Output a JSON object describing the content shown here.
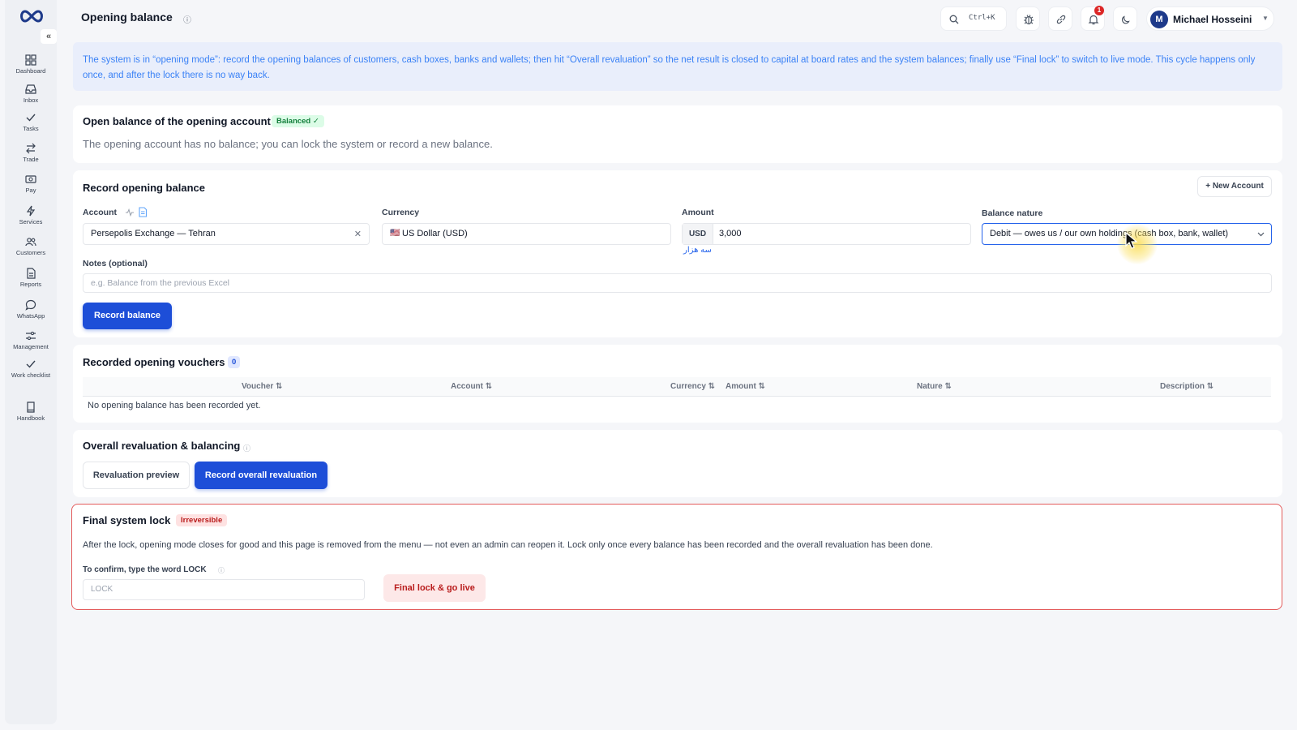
{
  "header": {
    "title": "Opening balance",
    "search_shortcut": "Ctrl+K",
    "notification_count": "1",
    "user_initial": "M",
    "user_name": "Michael Hosseini"
  },
  "sidebar": {
    "items": [
      {
        "label": "Dashboard",
        "icon": "dashboard-icon"
      },
      {
        "label": "Inbox",
        "icon": "inbox-icon"
      },
      {
        "label": "Tasks",
        "icon": "check-icon"
      },
      {
        "label": "Trade",
        "icon": "swap-icon"
      },
      {
        "label": "Pay",
        "icon": "pay-icon"
      },
      {
        "label": "Services",
        "icon": "bolt-icon"
      },
      {
        "label": "Customers",
        "icon": "users-icon"
      },
      {
        "label": "Reports",
        "icon": "report-icon"
      },
      {
        "label": "WhatsApp",
        "icon": "chat-icon"
      },
      {
        "label": "Management",
        "icon": "sliders-icon"
      },
      {
        "label": "Work checklist",
        "icon": "check-icon"
      },
      {
        "label": "Handbook",
        "icon": "book-icon"
      }
    ]
  },
  "banner": {
    "text": "The system is in “opening mode”: record the opening balances of customers, cash boxes, banks and wallets; then hit “Overall revaluation” so the net result is closed to capital at board rates and the system balances; finally use “Final lock” to switch to live mode. This cycle happens only once, and after the lock there is no way back."
  },
  "opening_account": {
    "title": "Open balance of the opening account",
    "status": "Balanced ✓",
    "message": "The opening account has no balance; you can lock the system or record a new balance."
  },
  "record_form": {
    "title": "Record opening balance",
    "new_account_label": "+ New Account",
    "account_label": "Account",
    "account_value": "Persepolis Exchange — Tehran",
    "currency_label": "Currency",
    "currency_flag": "🇺🇸",
    "currency_value": "US Dollar (USD)",
    "amount_label": "Amount",
    "amount_currency": "USD",
    "amount_value": "3,000",
    "amount_words": "سه هزار",
    "nature_label": "Balance nature",
    "nature_value": "Debit — owes us / our own holdings (cash box, bank, wallet)",
    "notes_label": "Notes (optional)",
    "notes_placeholder": "e.g. Balance from the previous Excel",
    "submit_label": "Record balance"
  },
  "vouchers": {
    "title": "Recorded opening vouchers",
    "count": "0",
    "columns": [
      "Voucher ⇅",
      "Account ⇅",
      "Currency ⇅",
      "Amount ⇅",
      "Nature ⇅",
      "Description ⇅"
    ],
    "empty_message": "No opening balance has been recorded yet."
  },
  "revaluation": {
    "title": "Overall revaluation & balancing",
    "preview_label": "Revaluation preview",
    "record_label": "Record overall revaluation"
  },
  "final_lock": {
    "title": "Final system lock",
    "badge": "Irreversible",
    "description": "After the lock, opening mode closes for good and this page is removed from the menu — not even an admin can reopen it. Lock only once every balance has been recorded and the overall revaluation has been done.",
    "confirm_label": "To confirm, type the word LOCK",
    "confirm_placeholder": "LOCK",
    "button_label": "Final lock & go live"
  },
  "colors": {
    "primary": "#1d4ed8",
    "banner_text": "#3b82f6",
    "danger": "#b91c1c",
    "success": "#15803d"
  }
}
